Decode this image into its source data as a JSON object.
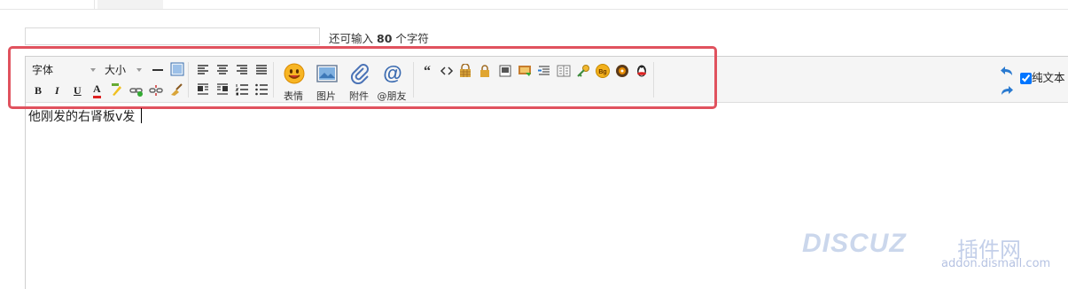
{
  "subject": {
    "placeholder": "",
    "hint_prefix": "还可输入",
    "hint_count": "80",
    "hint_suffix": "个字符"
  },
  "toolbar": {
    "font_select": "字体",
    "size_select": "大小",
    "bold": "B",
    "italic": "I",
    "underline": "U",
    "font_color": "A",
    "emoticon_label": "表情",
    "image_label": "图片",
    "attach_label": "附件",
    "mention_label": "@朋友",
    "plain_text_label": "纯文本",
    "plain_text_checked": true
  },
  "editor": {
    "content": "他刚发的右肾板v发"
  },
  "watermark": {
    "logo": "DISCUZ",
    "brand": "插件网",
    "url": "addon.dismall.com"
  },
  "colors": {
    "highlight_border": "#e0525e",
    "toolbar_bg": "#f5f5f5"
  }
}
